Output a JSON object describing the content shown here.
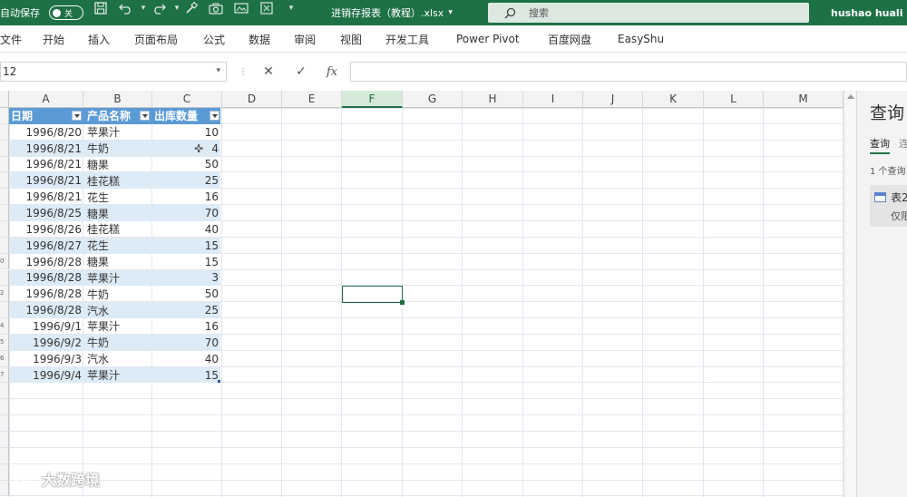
{
  "titlebar": {
    "autosave_label": "自动保存",
    "autosave_state": "关",
    "filename": "进销存报表（教程）.xlsx",
    "filename_arrow": "▾",
    "search_placeholder": "搜索",
    "user": "hushao huali"
  },
  "ribbon": {
    "tabs": [
      "文件",
      "开始",
      "插入",
      "页面布局",
      "公式",
      "数据",
      "审阅",
      "视图",
      "开发工具",
      "Power Pivot",
      "百度网盘",
      "EasyShu"
    ]
  },
  "formula_bar": {
    "name_box": "12",
    "cancel": "✕",
    "enter": "✓",
    "fx": "fx",
    "value": ""
  },
  "columns": [
    "A",
    "B",
    "C",
    "D",
    "E",
    "F",
    "G",
    "H",
    "I",
    "J",
    "K",
    "L",
    "M"
  ],
  "selected_column": "F",
  "row_numbers": [
    "",
    "",
    "",
    "",
    "",
    "",
    "",
    "",
    "",
    "0",
    "",
    "2",
    "",
    "4",
    "5",
    "6",
    "7",
    "",
    "",
    "",
    "",
    "",
    "",
    ""
  ],
  "table": {
    "headers": [
      "日期",
      "产品名称",
      "出库数量"
    ],
    "rows": [
      [
        "1996/8/20",
        "苹果汁",
        "10"
      ],
      [
        "1996/8/21",
        "牛奶",
        "4"
      ],
      [
        "1996/8/21",
        "糖果",
        "50"
      ],
      [
        "1996/8/21",
        "桂花糕",
        "25"
      ],
      [
        "1996/8/21",
        "花生",
        "16"
      ],
      [
        "1996/8/25",
        "糖果",
        "70"
      ],
      [
        "1996/8/26",
        "桂花糕",
        "40"
      ],
      [
        "1996/8/27",
        "花生",
        "15"
      ],
      [
        "1996/8/28",
        "糖果",
        "15"
      ],
      [
        "1996/8/28",
        "苹果汁",
        "3"
      ],
      [
        "1996/8/28",
        "牛奶",
        "50"
      ],
      [
        "1996/8/28",
        "汽水",
        "25"
      ],
      [
        "1996/9/1",
        "苹果汁",
        "16"
      ],
      [
        "1996/9/2",
        "牛奶",
        "70"
      ],
      [
        "1996/9/3",
        "汽水",
        "40"
      ],
      [
        "1996/9/4",
        "苹果汁",
        "15"
      ]
    ]
  },
  "query_pane": {
    "title": "查询",
    "tab_active": "查询",
    "tab_other": "连",
    "count": "1 个查询",
    "item_name": "表2",
    "item_sub": "仅限连接"
  },
  "watermark": "大数跨境",
  "colors": {
    "titlebar": "#1e7145",
    "table_header": "#5b9bd5",
    "table_band": "#ddebf7",
    "selection": "#1f6e43"
  }
}
